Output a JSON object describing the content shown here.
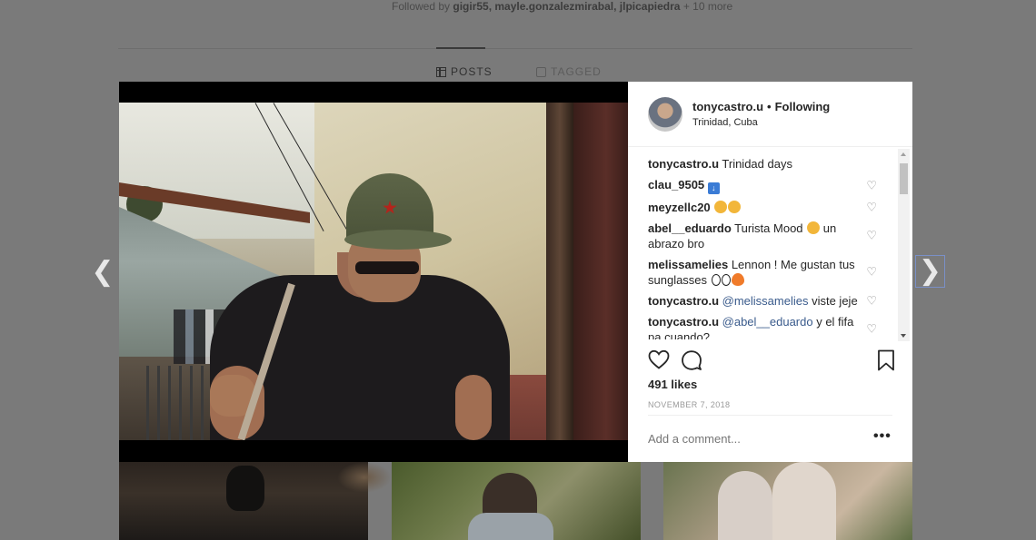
{
  "background": {
    "followed_by_prefix": "Followed by",
    "followed_by_users": "gigir55, mayle.gonzalezmirabal, jlpicapiedra",
    "followed_by_more": "+ 10 more",
    "tabs": [
      {
        "label": "POSTS",
        "icon": "grid-icon",
        "active": true
      },
      {
        "label": "TAGGED",
        "icon": "tag-icon",
        "active": false
      }
    ]
  },
  "navigation": {
    "prev_icon": "chevron-left-icon",
    "prev_glyph": "❮",
    "next_icon": "chevron-right-icon",
    "next_glyph": "❯"
  },
  "post": {
    "header": {
      "username": "tonycastro.u",
      "separator": "•",
      "follow_status": "Following",
      "location": "Trinidad, Cuba"
    },
    "comments": [
      {
        "user": "tonycastro.u",
        "text": "Trinidad days",
        "has_like": false
      },
      {
        "user": "clau_9505",
        "text": "",
        "emoji": "blue-square",
        "has_like": true
      },
      {
        "user": "meyzellc20",
        "text": "",
        "emoji": "two-smiley",
        "has_like": true
      },
      {
        "user": "abel__eduardo",
        "text": "Turista Mood",
        "text2": "un abrazo bro",
        "emoji": "laugh",
        "has_like": true
      },
      {
        "user": "melissamelies",
        "text": "Lennon ! Me gustan tus sunglasses",
        "emoji": "eyes-fire",
        "has_like": true
      },
      {
        "user": "tonycastro.u",
        "mention": "@melissamelies",
        "text": "viste jeje",
        "has_like": true
      },
      {
        "user": "tonycastro.u",
        "mention": "@abel__eduardo",
        "text": "y el fifa pa cuando?",
        "has_like": true
      }
    ],
    "likes": "491 likes",
    "date": "NOVEMBER 7, 2018",
    "add_comment_placeholder": "Add a comment...",
    "more_label": "•••",
    "heart_glyph": "♡",
    "colors": {
      "mention": "#3a5b8c",
      "text": "#262626",
      "muted": "#999999"
    }
  }
}
